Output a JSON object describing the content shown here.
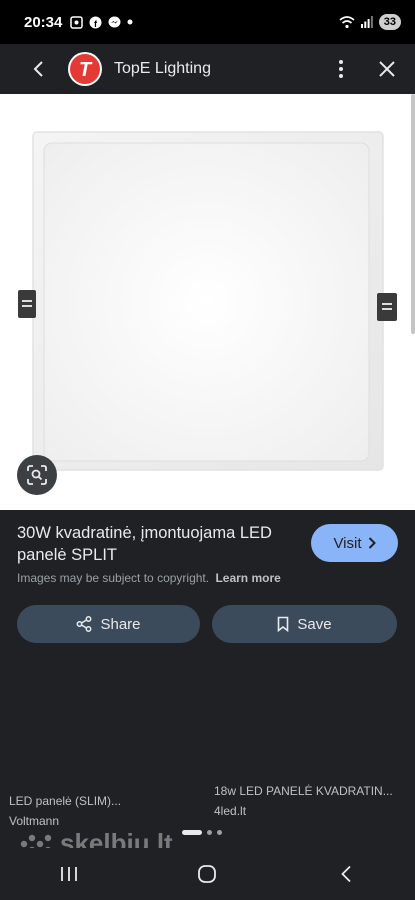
{
  "status_bar": {
    "time": "20:34",
    "battery": "33"
  },
  "header": {
    "site_name": "TopE Lighting",
    "logo_letter": "T",
    "logo_color": "#e53935"
  },
  "result": {
    "title": "30W kvadratinė, įmontuojama LED panelė SPLIT",
    "visit_label": "Visit",
    "copyright_text": "Images may be subject to copyright.",
    "learn_more": "Learn more",
    "share_label": "Share",
    "save_label": "Save"
  },
  "related": [
    {
      "title": "LED panelė (SLIM)...",
      "source": "Voltmann"
    },
    {
      "title": "18w LED PANELĖ KVADRATIN...",
      "source": "4led.lt"
    }
  ],
  "watermark": "skelbiu.lt",
  "colors": {
    "accent": "#8ab4f8",
    "button_bg": "#3c4b5c",
    "background": "#202124"
  }
}
